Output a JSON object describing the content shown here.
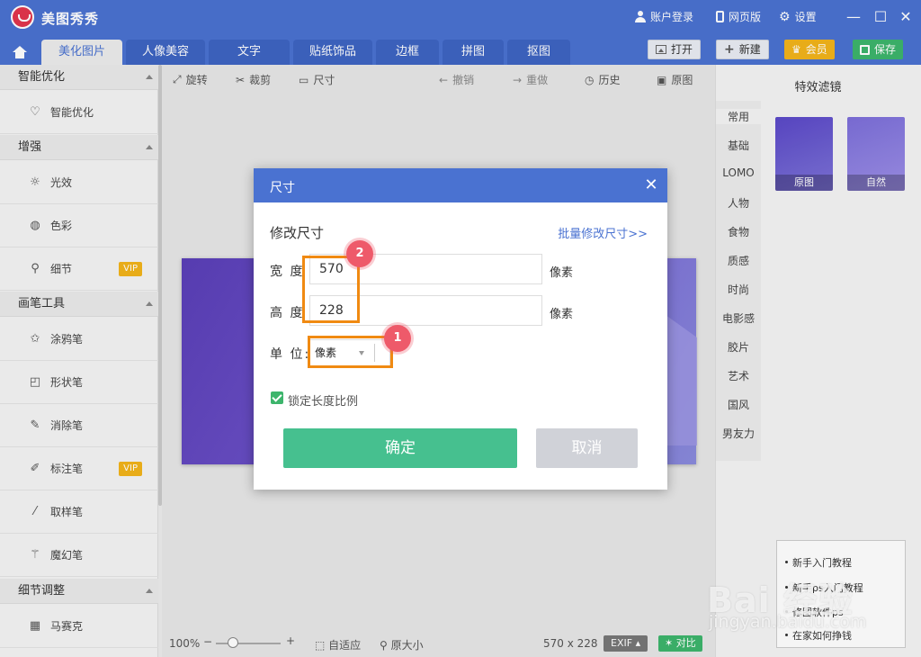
{
  "app": {
    "title": "美图秀秀"
  },
  "titlebar": {
    "login": "账户登录",
    "web": "网页版",
    "settings": "设置"
  },
  "tabs": [
    "美化图片",
    "人像美容",
    "文字",
    "贴纸饰品",
    "边框",
    "拼图",
    "抠图"
  ],
  "actions": {
    "open": "打开",
    "new": "新建",
    "vip": "会员",
    "save": "保存"
  },
  "sidebar": {
    "sections": [
      {
        "title": "智能优化",
        "items": [
          {
            "label": "智能优化",
            "icon": "bulb-icon"
          }
        ]
      },
      {
        "title": "增强",
        "items": [
          {
            "label": "光效",
            "icon": "sun-icon"
          },
          {
            "label": "色彩",
            "icon": "palette-icon"
          },
          {
            "label": "细节",
            "icon": "magnifier-icon",
            "badge": "VIP"
          }
        ]
      },
      {
        "title": "画笔工具",
        "items": [
          {
            "label": "涂鸦笔",
            "icon": "doodle-icon"
          },
          {
            "label": "形状笔",
            "icon": "shape-icon"
          },
          {
            "label": "消除笔",
            "icon": "eraser-icon"
          },
          {
            "label": "标注笔",
            "icon": "annotate-pen-icon",
            "badge": "VIP"
          },
          {
            "label": "取样笔",
            "icon": "eyedropper-icon"
          },
          {
            "label": "魔幻笔",
            "icon": "magic-wand-icon"
          }
        ]
      },
      {
        "title": "细节调整",
        "items": [
          {
            "label": "马赛克",
            "icon": "mosaic-icon"
          }
        ]
      }
    ]
  },
  "toolbar": {
    "rotate": "旋转",
    "crop": "裁剪",
    "size": "尺寸",
    "undo": "撤销",
    "redo": "重做",
    "history": "历史",
    "original": "原图"
  },
  "status": {
    "zoom": "100%",
    "minus": "−",
    "plus": "+",
    "fit": "自适应",
    "actual": "原大小",
    "dimensions": "570 x 228",
    "exif": "EXIF",
    "compare": "对比"
  },
  "right": {
    "title": "特效滤镜",
    "categories": [
      "常用",
      "基础",
      "LOMO",
      "人物",
      "食物",
      "质感",
      "时尚",
      "电影感",
      "胶片",
      "艺术",
      "国风",
      "男友力"
    ],
    "thumbs": [
      "原图",
      "自然"
    ]
  },
  "ad": {
    "lines": [
      "新手入门教程",
      "新手ps入门教程",
      "修图软件ps",
      "在家如何挣钱"
    ]
  },
  "watermark": {
    "brand": "Bai 经验",
    "url": "jingyan.baidu.com"
  },
  "dialog": {
    "title": "尺寸",
    "close": "✕",
    "subtitle": "修改尺寸",
    "batch_link": "批量修改尺寸>>",
    "width_label": "宽 度",
    "width_value": "570",
    "height_label": "高 度",
    "height_value": "228",
    "unit_px": "像素",
    "unit_label": "单 位:",
    "unit_value": "像素",
    "lock_label": "锁定长度比例",
    "ok": "确定",
    "cancel": "取消"
  },
  "annotations": {
    "badge1": "1",
    "badge2": "2"
  },
  "colors": {
    "brand_blue": "#4a72d1",
    "confirm_green": "#46c08f",
    "annotation_orange": "#f08a12",
    "annotation_badge": "#ee5a6a",
    "vip_gold": "#f2b31b"
  }
}
